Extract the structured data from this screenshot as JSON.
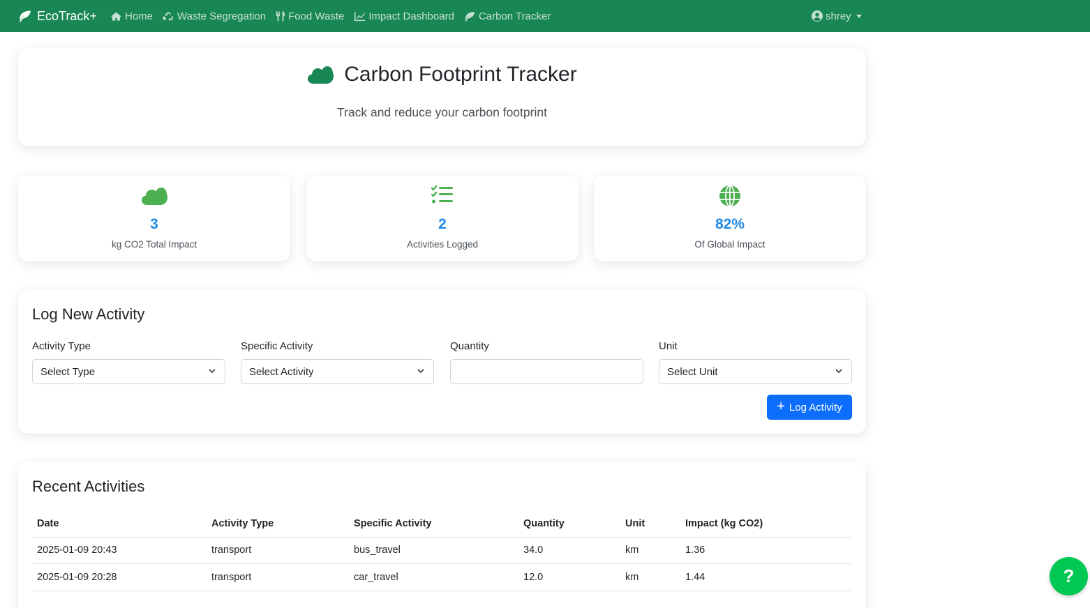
{
  "navbar": {
    "brand": "EcoTrack+",
    "links": [
      {
        "label": "Home",
        "icon": "home-icon"
      },
      {
        "label": "Waste Segregation",
        "icon": "recycle-icon"
      },
      {
        "label": "Food Waste",
        "icon": "utensils-icon"
      },
      {
        "label": "Impact Dashboard",
        "icon": "chart-line-icon"
      },
      {
        "label": "Carbon Tracker",
        "icon": "leaf-icon"
      }
    ],
    "user": "shrey"
  },
  "hero": {
    "title": "Carbon Footprint Tracker",
    "subtitle": "Track and reduce your carbon footprint"
  },
  "stats": [
    {
      "value": "3",
      "label": "kg CO2 Total Impact",
      "icon": "cloud-icon"
    },
    {
      "value": "2",
      "label": "Activities Logged",
      "icon": "tasks-icon"
    },
    {
      "value": "82%",
      "label": "Of Global Impact",
      "icon": "globe-icon"
    }
  ],
  "log_form": {
    "title": "Log New Activity",
    "fields": [
      {
        "label": "Activity Type",
        "value": "Select Type"
      },
      {
        "label": "Specific Activity",
        "value": "Select Activity"
      },
      {
        "label": "Quantity",
        "value": ""
      },
      {
        "label": "Unit",
        "value": "Select Unit"
      }
    ],
    "submit_label": "Log Activity"
  },
  "recent": {
    "title": "Recent Activities",
    "columns": [
      "Date",
      "Activity Type",
      "Specific Activity",
      "Quantity",
      "Unit",
      "Impact (kg CO2)"
    ],
    "rows": [
      [
        "2025-01-09 20:43",
        "transport",
        "bus_travel",
        "34.0",
        "km",
        "1.36"
      ],
      [
        "2025-01-09 20:28",
        "transport",
        "car_travel",
        "12.0",
        "km",
        "1.44"
      ]
    ]
  },
  "help": {
    "label": "?"
  },
  "colors": {
    "navbar": "#198754",
    "accent_green": "#4caf50",
    "stat_value": "#1e88e5",
    "primary_button": "#0d6efd",
    "help_button": "#00c853"
  }
}
